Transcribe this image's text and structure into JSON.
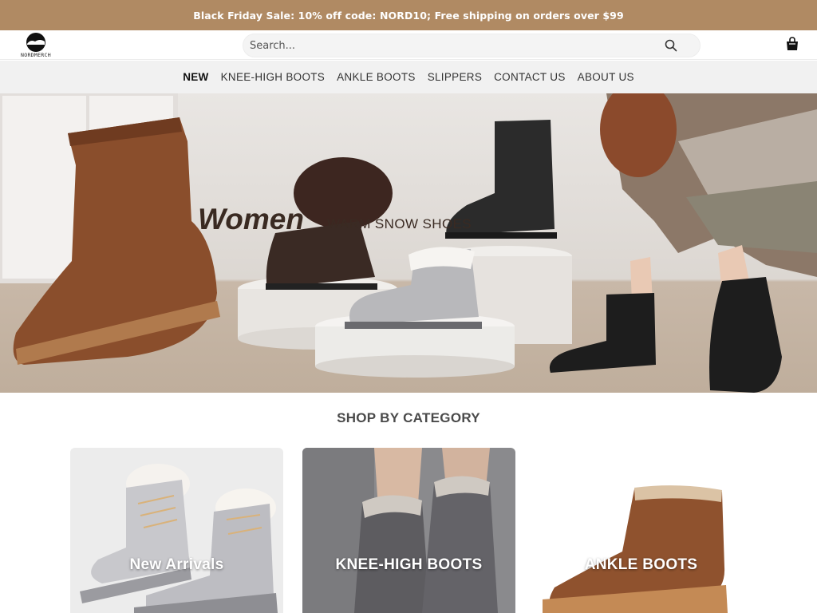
{
  "promo": {
    "text": "Black Friday Sale: 10% off code: NORD10; Free shipping on orders over $99"
  },
  "header": {
    "logo_text": "NORDMERCH",
    "search_placeholder": "Search...",
    "icons": {
      "search": "search-icon",
      "cart": "shopping-bag-icon"
    }
  },
  "nav": {
    "items": [
      {
        "label": "NEW",
        "active": true
      },
      {
        "label": "KNEE-HIGH BOOTS"
      },
      {
        "label": "ANKLE BOOTS"
      },
      {
        "label": "SLIPPERS"
      },
      {
        "label": "CONTACT US"
      },
      {
        "label": "ABOUT US"
      }
    ]
  },
  "hero": {
    "title": "Women",
    "subtitle": "WARM SNOW SHOES"
  },
  "section": {
    "title": "SHOP BY CATEGORY"
  },
  "categories": [
    {
      "label": "New Arrivals"
    },
    {
      "label": "KNEE-HIGH BOOTS"
    },
    {
      "label": "ANKLE BOOTS"
    }
  ],
  "colors": {
    "promo_bg": "#b08a63",
    "nav_bg": "#f1f1f1",
    "text_dark": "#222222"
  }
}
